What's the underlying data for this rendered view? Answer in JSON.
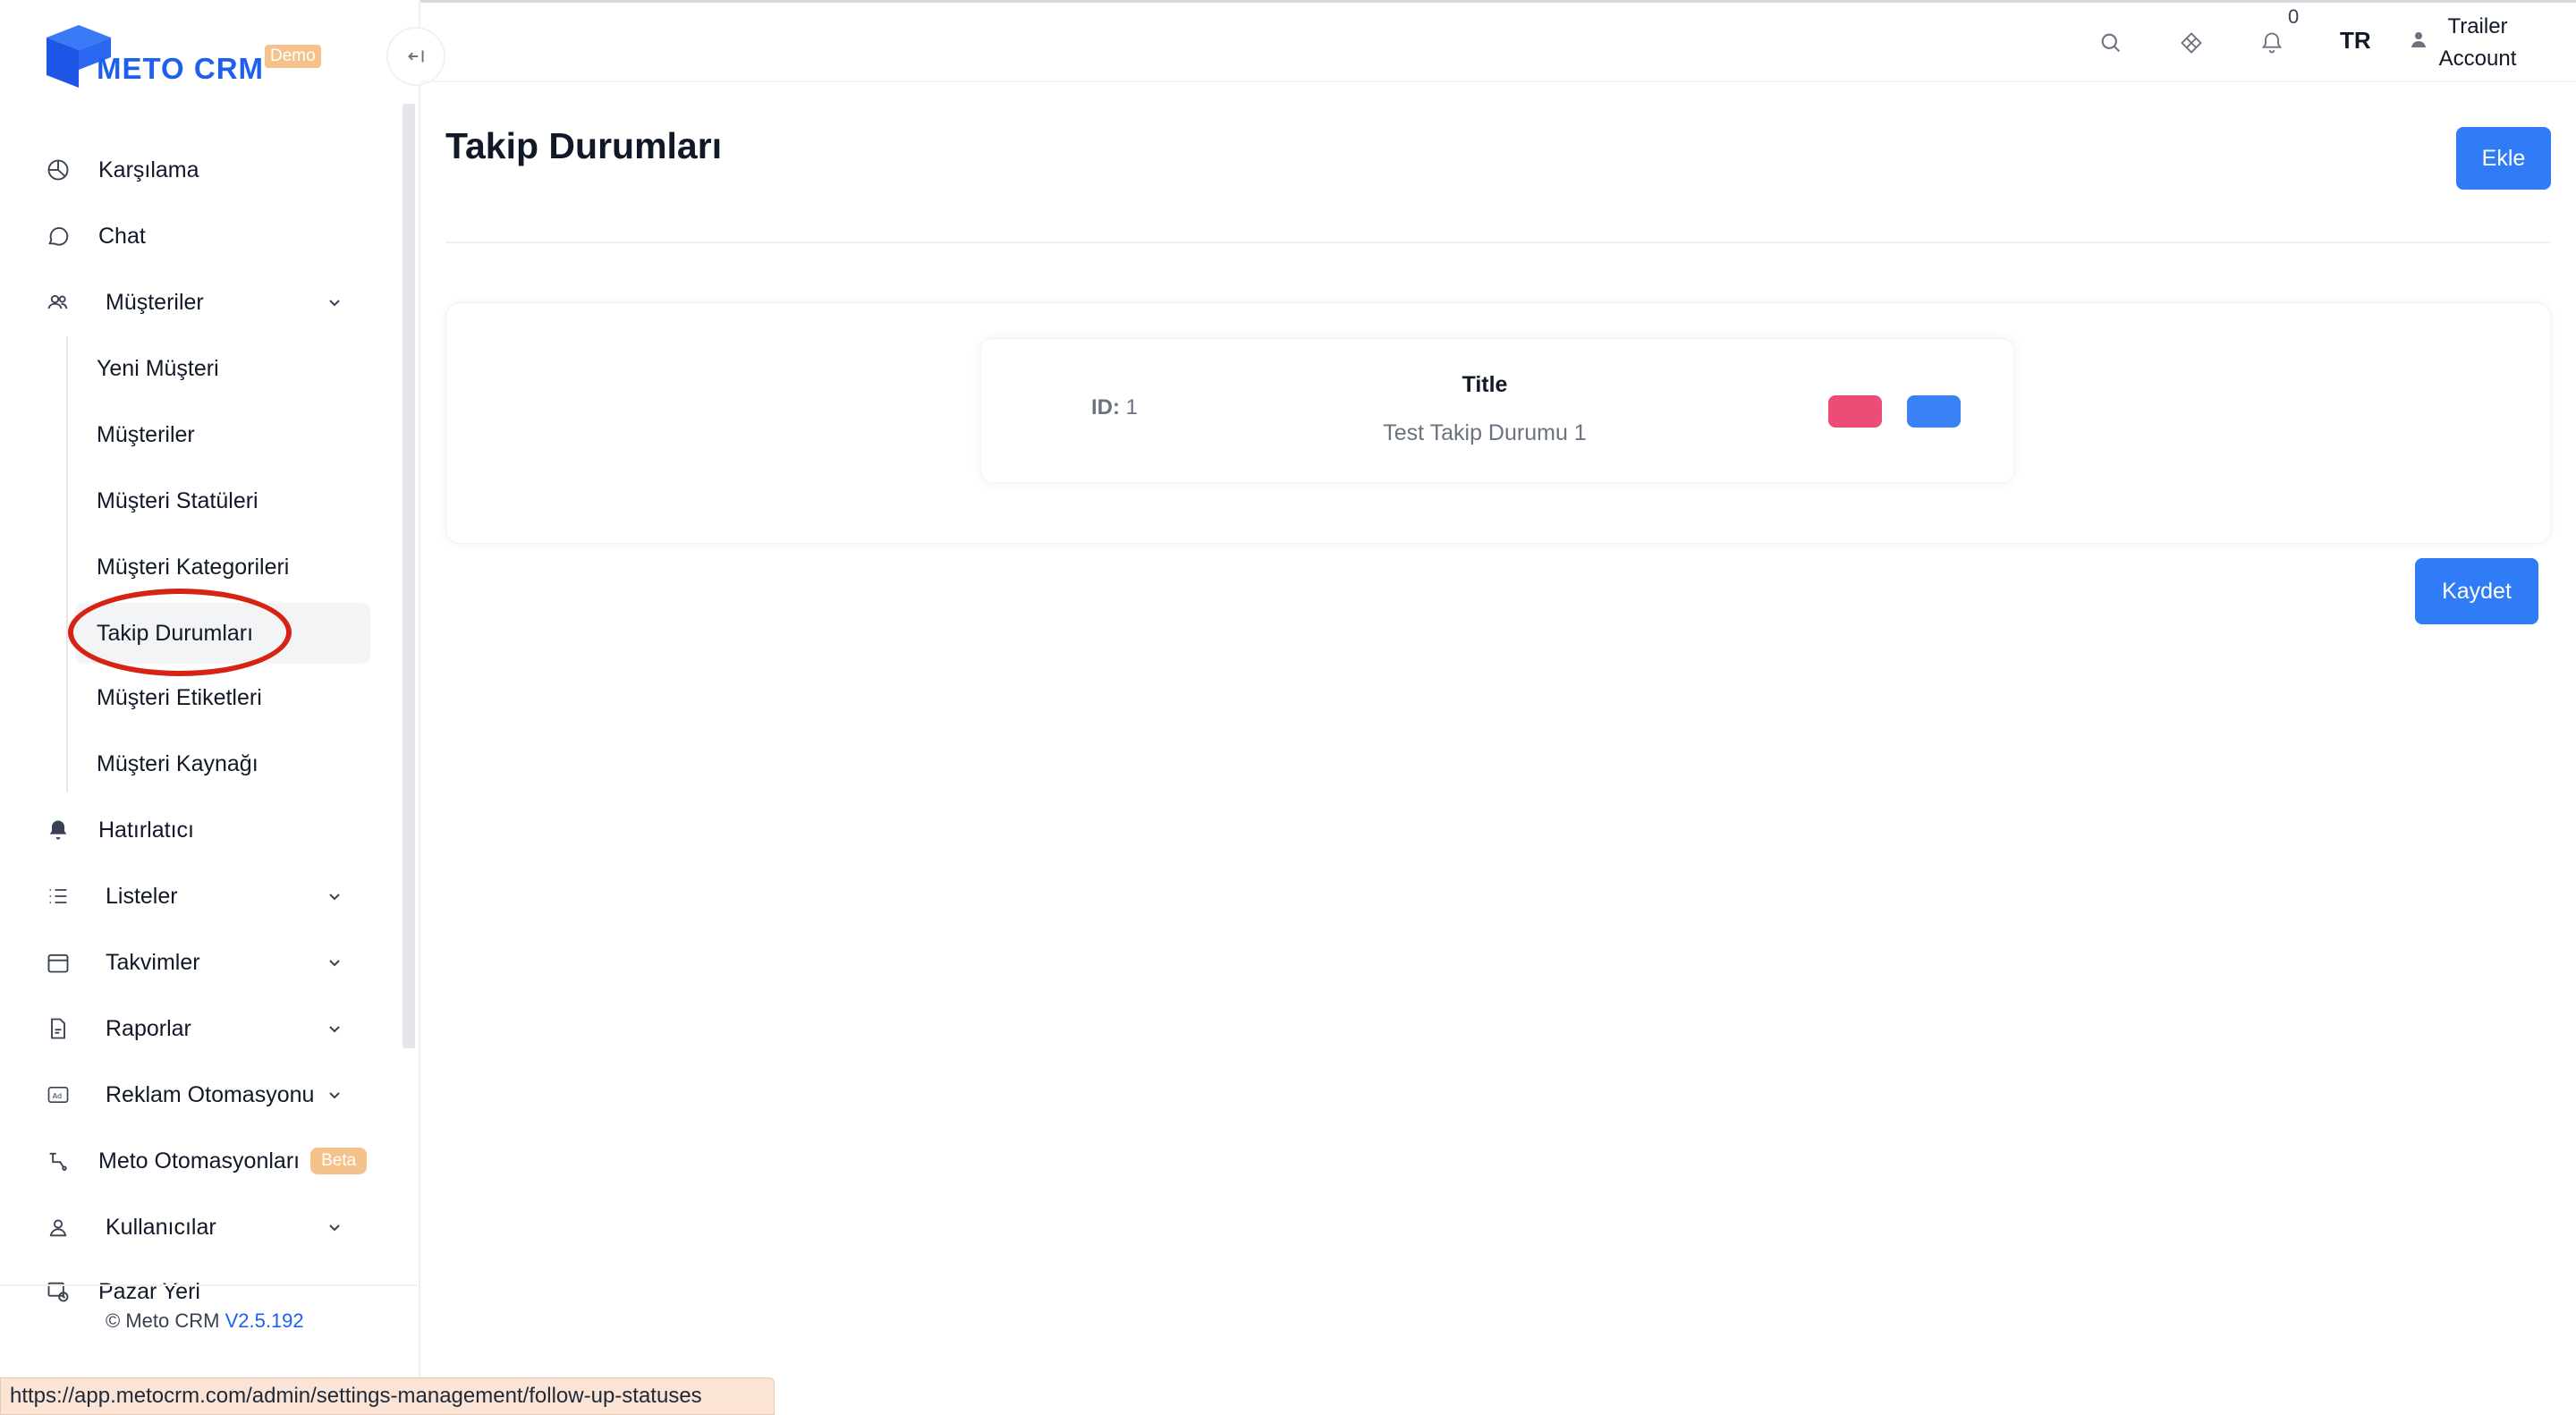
{
  "app": {
    "logo_text": "METO CRM",
    "demo_badge": "Demo",
    "accent_color": "#2f7cf6",
    "brand_color": "#1f5ff0"
  },
  "sidebar": {
    "items": [
      {
        "label": "Karşılama",
        "icon": "pie-chart-icon"
      },
      {
        "label": "Chat",
        "icon": "chat-bubble-icon"
      },
      {
        "label": "Müşteriler",
        "icon": "users-icon",
        "expanded": true,
        "children": [
          {
            "label": "Yeni Müşteri"
          },
          {
            "label": "Müşteriler"
          },
          {
            "label": "Müşteri Statüleri"
          },
          {
            "label": "Müşteri Kategorileri"
          },
          {
            "label": "Takip Durumları",
            "active": true
          },
          {
            "label": "Müşteri Etiketleri"
          },
          {
            "label": "Müşteri Kaynağı"
          }
        ]
      },
      {
        "label": "Hatırlatıcı",
        "icon": "bell-icon"
      },
      {
        "label": "Listeler",
        "icon": "list-icon"
      },
      {
        "label": "Takvimler",
        "icon": "calendar-icon"
      },
      {
        "label": "Raporlar",
        "icon": "report-icon"
      },
      {
        "label": "Reklam Otomasyonu",
        "icon": "ad-icon"
      },
      {
        "label": "Meto Otomasyonları",
        "icon": "automation-icon",
        "badge": "Beta"
      },
      {
        "label": "Kullanıcılar",
        "icon": "user-icon"
      },
      {
        "label": "Pazar Yeri",
        "icon": "marketplace-icon"
      }
    ],
    "copyright_prefix": "© Meto CRM",
    "version": "V2.5.192"
  },
  "topbar": {
    "notification_count": "0",
    "language": "TR",
    "user_line1": "Trailer",
    "user_line2": "Account"
  },
  "main": {
    "title": "Takip Durumları",
    "add_button": "Ekle",
    "save_button": "Kaydet",
    "record": {
      "id_label": "ID:",
      "id_value": "1",
      "title_header": "Title",
      "title_value": "Test Takip Durumu 1",
      "delete_color": "#ec4c75",
      "edit_color": "#3b82f6"
    }
  },
  "status_bar": {
    "url": "https://app.metocrm.com/admin/settings-management/follow-up-statuses"
  }
}
